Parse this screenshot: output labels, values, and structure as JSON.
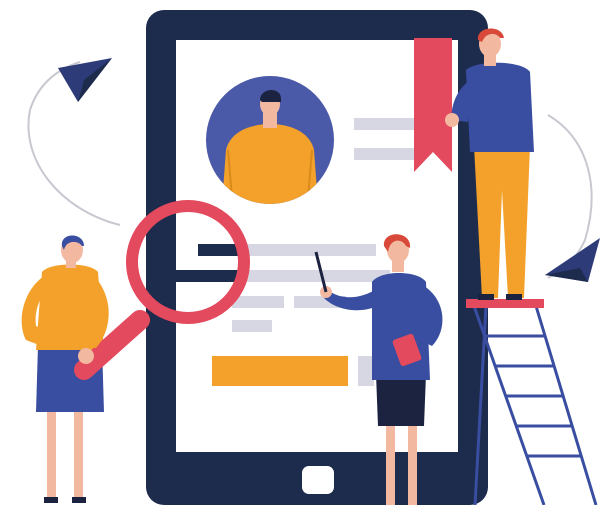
{
  "colors": {
    "background": "#ffffff",
    "tablet_frame": "#1d2b4c",
    "tablet_screen": "#ffffff",
    "placeholder_gray": "#d6d7e2",
    "avatar_circle": "#4a5aa8",
    "orange": "#f3a12a",
    "red_accent": "#e34a5d",
    "blue_clothes": "#3a4ea1",
    "skin": "#f3b8a0",
    "hair_dark": "#1c2340",
    "hair_red": "#d9493a",
    "paper_plane": "#2d3c78",
    "ladder": "#3a4ea1",
    "arc_gray": "#c8c8d0"
  },
  "icons": {
    "magnifier": "magnifier-icon",
    "bookmark": "bookmark-icon",
    "paper_plane_left": "paper-plane-icon",
    "paper_plane_right": "paper-plane-icon",
    "home_button": "home-button-icon",
    "avatar": "profile-avatar-icon"
  }
}
